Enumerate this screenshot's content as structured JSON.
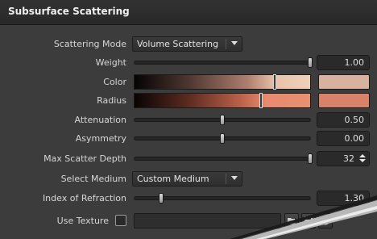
{
  "header": {
    "title": "Subsurface Scattering"
  },
  "scattering_mode": {
    "label": "Scattering Mode",
    "value": "Volume Scattering"
  },
  "weight": {
    "label": "Weight",
    "value": "1.00",
    "level": 1.0
  },
  "color": {
    "label": "Color",
    "swatch_color": "#d8b29f",
    "ramp_stops": [
      "#050404",
      "#4b3530",
      "#b08070",
      "#e8c2aa",
      "#f0d0ba"
    ],
    "marker_level": 0.8
  },
  "radius": {
    "label": "Radius",
    "swatch_color": "#d9826a",
    "ramp_stops": [
      "#080403",
      "#5a2a20",
      "#b8604a",
      "#e88a70",
      "#e89070"
    ],
    "marker_level": 0.72
  },
  "attenuation": {
    "label": "Attenuation",
    "value": "0.50",
    "level": 0.5
  },
  "asymmetry": {
    "label": "Asymmetry",
    "value": "0.00",
    "level": 0.5
  },
  "max_scatter_depth": {
    "label": "Max Scatter Depth",
    "value": "32",
    "level": 1.0
  },
  "select_medium": {
    "label": "Select Medium",
    "value": "Custom Medium"
  },
  "index_of_refraction": {
    "label": "Index of Refraction",
    "value": "1.30",
    "level": 0.15
  },
  "use_texture": {
    "label": "Use Texture",
    "checked": false,
    "value": "",
    "icons": [
      "folder-open-icon",
      "save-icon",
      "reload-icon"
    ]
  },
  "colors": {
    "panel_bg": "#3c3c3c",
    "header_bg": "#2c2c2c",
    "field_bg": "#2a2a2a",
    "text": "#d8d8d8"
  }
}
